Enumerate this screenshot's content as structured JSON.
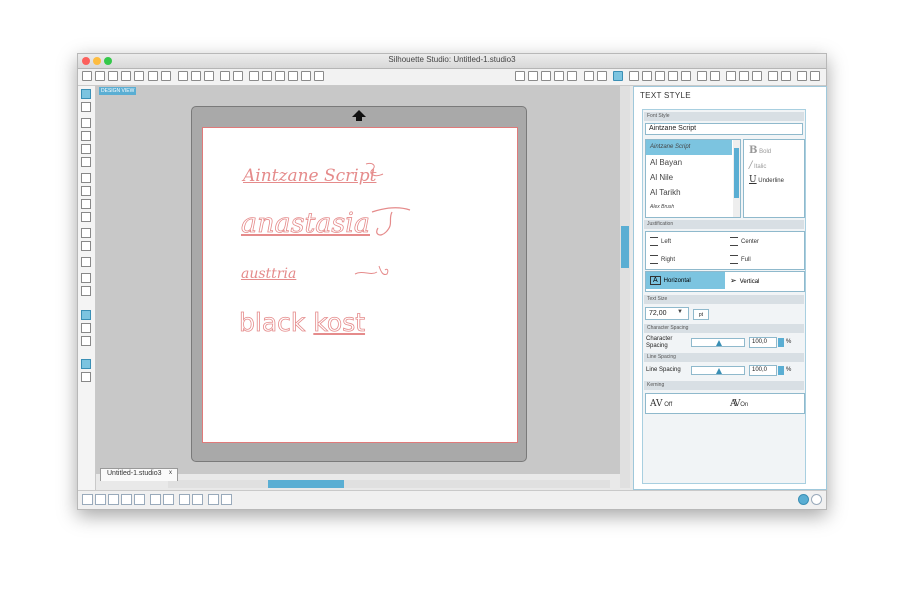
{
  "window": {
    "title": "Silhouette Studio: Untitled-1.studio3"
  },
  "canvas": {
    "view_label": "DESIGN VIEW",
    "texts": [
      "Aintzane Script",
      "anastasia",
      "austtria",
      "black",
      "kost"
    ],
    "doc_tab": "Untitled-1.studio3",
    "doc_tab_close": "x"
  },
  "panel": {
    "title": "TEXT STYLE",
    "font_style": {
      "section": "Font Style",
      "current_font": "Aintzane Script",
      "fonts": [
        "Aintzane Script",
        "Al Bayan",
        "Al Nile",
        "Al Tarikh",
        "Alex Brush"
      ],
      "bold": "Bold",
      "italic": "Italic",
      "underline": "Underline"
    },
    "justification": {
      "section": "Justification",
      "left": "Left",
      "center": "Center",
      "right": "Right",
      "full": "Full",
      "horizontal": "Horizontal",
      "vertical": "Vertical"
    },
    "text_size": {
      "section": "Text Size",
      "value": "72,00",
      "unit": "pt"
    },
    "character_spacing": {
      "section": "Character Spacing",
      "label": "Character Spacing",
      "value": "100,0",
      "unit": "%"
    },
    "line_spacing": {
      "section": "Line Spacing",
      "label": "Line Spacing",
      "value": "100,0",
      "unit": "%"
    },
    "kerning": {
      "section": "Kerning",
      "off": "Off",
      "on": "On"
    }
  },
  "colors": {
    "accent": "#5aaed3",
    "text_outline": "#e58b8b"
  }
}
